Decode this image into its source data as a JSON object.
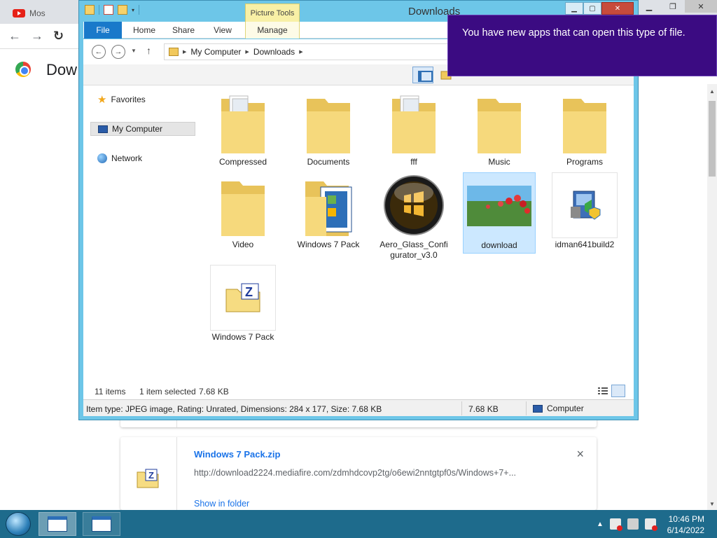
{
  "chrome": {
    "tab_title": "Mos",
    "page_heading": "Dow",
    "nav": {
      "back": "←",
      "forward": "→",
      "reload": "↻"
    }
  },
  "downloads": {
    "item": {
      "filename": "Windows 7 Pack.zip",
      "url": "http://download2224.mediafire.com/zdmhdcovp2tg/o6ewi2nntgtpf0s/Windows+7+...",
      "show_in_folder": "Show in folder",
      "close": "×"
    }
  },
  "explorer": {
    "title": "Downloads",
    "context_tab": "Picture Tools",
    "ribbon_tabs": [
      "File",
      "Home",
      "Share",
      "View",
      "Manage"
    ],
    "breadcrumb": [
      "My Computer",
      "Downloads"
    ],
    "nav_pane": [
      "Favorites",
      "My Computer",
      "Network"
    ],
    "items": [
      {
        "label": "Compressed",
        "icon": "folder-icon"
      },
      {
        "label": "Documents",
        "icon": "folder-icon"
      },
      {
        "label": "fff",
        "icon": "folder-icon"
      },
      {
        "label": "Music",
        "icon": "folder-icon"
      },
      {
        "label": "Programs",
        "icon": "folder-icon"
      },
      {
        "label": "Video",
        "icon": "folder-icon"
      },
      {
        "label": "Windows 7 Pack",
        "icon": "folder-icon"
      },
      {
        "label": "Aero_Glass_Configurator_v3.0",
        "icon": "aero-glass-icon"
      },
      {
        "label": "download",
        "icon": "image-thumbnail-icon"
      },
      {
        "label": "idman641build2",
        "icon": "installer-icon"
      },
      {
        "label": "Windows 7 Pack",
        "icon": "zip-archive-icon"
      }
    ],
    "status": {
      "count": "11 items",
      "selected": "1 item selected",
      "size": "7.68 KB"
    },
    "details_bar": {
      "details": "Item type: JPEG image, Rating: Unrated, Dimensions: 284 x 177, Size: 7.68 KB",
      "size": "7.68 KB",
      "location": "Computer"
    }
  },
  "toast": {
    "message": "You have new apps that can open this type of file."
  },
  "taskbar": {
    "time": "10:46 PM",
    "date": "6/14/2022"
  }
}
